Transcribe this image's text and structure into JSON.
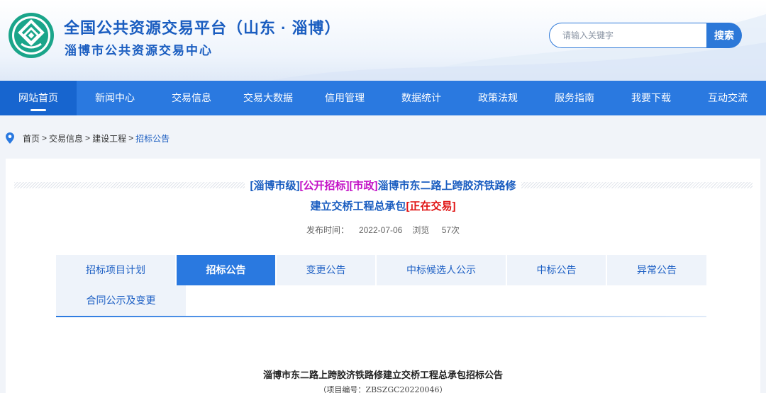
{
  "header": {
    "title": "全国公共资源交易平台（山东 · 淄博）",
    "subtitle": "淄博市公共资源交易中心",
    "logo_icon": "emblem-logo-icon",
    "search": {
      "placeholder": "请输入关键字",
      "button_label": "搜索"
    }
  },
  "nav": {
    "items": [
      {
        "label": "网站首页",
        "active": true
      },
      {
        "label": "新闻中心"
      },
      {
        "label": "交易信息"
      },
      {
        "label": "交易大数据"
      },
      {
        "label": "信用管理"
      },
      {
        "label": "数据统计"
      },
      {
        "label": "政策法规"
      },
      {
        "label": "服务指南"
      },
      {
        "label": "我要下载"
      },
      {
        "label": "互动交流"
      }
    ]
  },
  "breadcrumb": {
    "icon": "location-pin-icon",
    "items": [
      "首页",
      "交易信息",
      "建设工程",
      "招标公告"
    ],
    "separator": ">"
  },
  "document": {
    "tag_level": "[淄博市级]",
    "tag_method": "[公开招标]",
    "tag_category": "[市政]",
    "title_main": "淄博市东二路上跨胶济铁路修建立交桥工程总承包",
    "tag_status": "[正在交易]",
    "publish_label": "发布时间：",
    "publish_date": "2022-07-06",
    "views_label": "浏览",
    "views_count": "57次"
  },
  "tabs": {
    "items": [
      {
        "label": "招标项目计划"
      },
      {
        "label": "招标公告",
        "active": true
      },
      {
        "label": "变更公告"
      },
      {
        "label": "中标候选人公示"
      },
      {
        "label": "中标公告"
      },
      {
        "label": "异常公告"
      },
      {
        "label": "合同公示及变更"
      }
    ]
  },
  "article": {
    "title": "淄博市东二路上跨胶济铁路修建立交桥工程总承包招标公告",
    "project_no": "（项目编号：ZBSZGC20220046）"
  },
  "colors": {
    "primary": "#2a79e0",
    "title_blue": "#1a5dc0",
    "tag_purple": "#c312c6",
    "tag_red": "#e01414"
  }
}
